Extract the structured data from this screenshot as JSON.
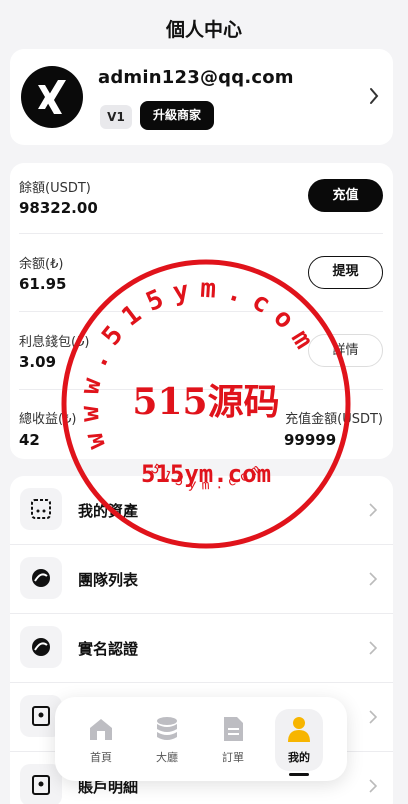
{
  "header": {
    "title": "個人中心"
  },
  "profile": {
    "email": "admin123@qq.com",
    "level": "V1",
    "upgrade_label": "升級商家"
  },
  "balances": {
    "usdt_label": "餘額(USDT)",
    "usdt_value": "98322.00",
    "recharge_label": "充值",
    "rmb_label": "余额(₺)",
    "rmb_value": "61.95",
    "withdraw_label": "提現",
    "interest_label": "利息錢包(₺)",
    "interest_value": "3.09",
    "detail_label": "詳情",
    "total_income_label": "總收益(₺)",
    "total_income_value": "42",
    "recharge_amount_label": "充值金額(USDT)",
    "recharge_amount_value": "99999"
  },
  "menu": {
    "items": [
      {
        "label": "我的資產",
        "icon": "wallet-icon"
      },
      {
        "label": "團隊列表",
        "icon": "team-icon"
      },
      {
        "label": "實名認證",
        "icon": "verify-icon"
      },
      {
        "label": "",
        "icon": "record-icon"
      },
      {
        "label": "賬戶明細",
        "icon": "account-detail-icon"
      }
    ]
  },
  "nav": {
    "items": [
      {
        "label": "首頁",
        "icon": "home-icon"
      },
      {
        "label": "大廳",
        "icon": "lobby-icon"
      },
      {
        "label": "訂單",
        "icon": "order-icon"
      },
      {
        "label": "我的",
        "icon": "profile-icon",
        "active": true
      }
    ]
  },
  "watermark": {
    "arc_text": "www.515ym.com",
    "center_text": "515源码",
    "domain_text": "515ym.com",
    "bottom_arc_text": "515ym.com",
    "color": "#e0131b"
  },
  "colors": {
    "accent": "#0a0a0a",
    "background": "#f4f4f6",
    "stamp": "#e0131b"
  }
}
